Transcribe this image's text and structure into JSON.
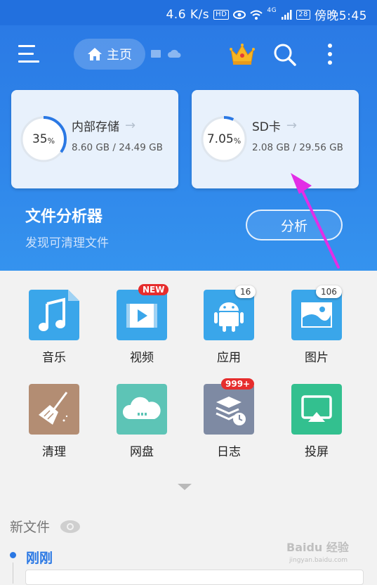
{
  "status_bar": {
    "speed": "4.6 K/s",
    "hd": "HD",
    "net": "4G",
    "battery": "28",
    "time": "傍晚5:45"
  },
  "header": {
    "home_label": "主页"
  },
  "storage": [
    {
      "name": "内部存储",
      "percent": "35",
      "percent_sign": "%",
      "usage": "8.60 GB / 24.49 GB",
      "fraction": 0.35
    },
    {
      "name": "SD卡",
      "percent": "7.05",
      "percent_sign": "%",
      "usage": "2.08 GB / 29.56 GB",
      "fraction": 0.0705
    }
  ],
  "analyzer": {
    "title": "文件分析器",
    "subtitle": "发现可清理文件",
    "button": "分析"
  },
  "categories": [
    {
      "label": "音乐",
      "icon": "music-icon",
      "color": "#3aa6ea"
    },
    {
      "label": "视频",
      "icon": "video-icon",
      "color": "#3aa6ea",
      "badge": "NEW"
    },
    {
      "label": "应用",
      "icon": "android-icon",
      "color": "#3aa6ea",
      "badge": "16"
    },
    {
      "label": "图片",
      "icon": "image-icon",
      "color": "#3aa6ea",
      "badge": "106"
    },
    {
      "label": "清理",
      "icon": "broom-icon",
      "color": "#b38d73"
    },
    {
      "label": "网盘",
      "icon": "cloud-icon",
      "color": "#5dc4b6"
    },
    {
      "label": "日志",
      "icon": "log-icon",
      "color": "#7e8aa3",
      "badge": "999+"
    },
    {
      "label": "投屏",
      "icon": "cast-icon",
      "color": "#33c08f"
    }
  ],
  "recent": {
    "title": "新文件",
    "group": "刚刚"
  },
  "watermark": {
    "brand": "Baidu 经验",
    "url": "jingyan.baidu.com"
  }
}
